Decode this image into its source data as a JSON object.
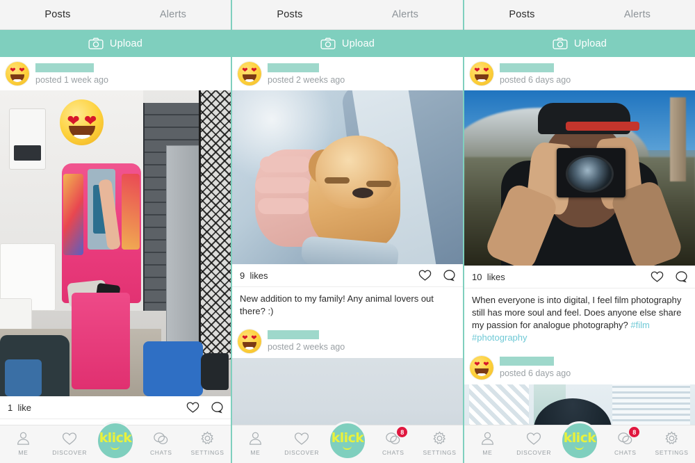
{
  "app": {
    "name": "klick",
    "accent_teal": "#7fcfbe",
    "logo_text_color": "#e9f13c",
    "badge_color": "#e0173f",
    "hashtag_color": "#6fc9d6",
    "redaction_color": "#9ed8cb"
  },
  "tabs": {
    "posts": "Posts",
    "alerts": "Alerts"
  },
  "upload": {
    "label": "Upload",
    "icon": "camera-icon"
  },
  "bottom_nav": {
    "items": [
      {
        "label": "ME",
        "icon": "person-icon",
        "badge": ""
      },
      {
        "label": "DISCOVER",
        "icon": "heart-icon",
        "badge": ""
      },
      {
        "label": "CHATS",
        "icon": "chat-bubbles-icon",
        "badge": "8"
      },
      {
        "label": "SETTINGS",
        "icon": "gear-icon",
        "badge": ""
      }
    ],
    "logo_label": "klick"
  },
  "panels": [
    {
      "id": "panel-1",
      "posts": [
        {
          "username_redacted": true,
          "timestamp": "posted 1 week ago",
          "image_alt": "locker-room-mirror-selfie",
          "likes_count": "1",
          "likes_word": "like",
          "caption": "",
          "hashtags": ""
        }
      ],
      "chats_badge": ""
    },
    {
      "id": "panel-2",
      "posts": [
        {
          "username_redacted": true,
          "timestamp": "posted 2 weeks ago",
          "image_alt": "puppy-held-in-arms",
          "likes_count": "9",
          "likes_word": "likes",
          "caption": "New addition to my family! Any animal lovers out there? :)",
          "hashtags": ""
        },
        {
          "username_redacted": true,
          "timestamp": "posted 2 weeks ago",
          "image_alt": "light-blue-gray-photo",
          "likes_count": "",
          "likes_word": "",
          "caption": "",
          "hashtags": ""
        }
      ],
      "chats_badge": "8"
    },
    {
      "id": "panel-3",
      "posts": [
        {
          "username_redacted": true,
          "timestamp": "posted 6 days ago",
          "image_alt": "person-shooting-film-camera",
          "likes_count": "10",
          "likes_word": "likes",
          "caption": "When everyone is into digital, I feel film photography still has more soul and feel. Does anyone else share my passion for analogue photography? ",
          "hashtags": "#film #photography"
        },
        {
          "username_redacted": true,
          "timestamp": "posted 6 days ago",
          "image_alt": "person-near-building-photo",
          "likes_count": "",
          "likes_word": "",
          "caption": "",
          "hashtags": ""
        }
      ],
      "chats_badge": "8"
    }
  ]
}
